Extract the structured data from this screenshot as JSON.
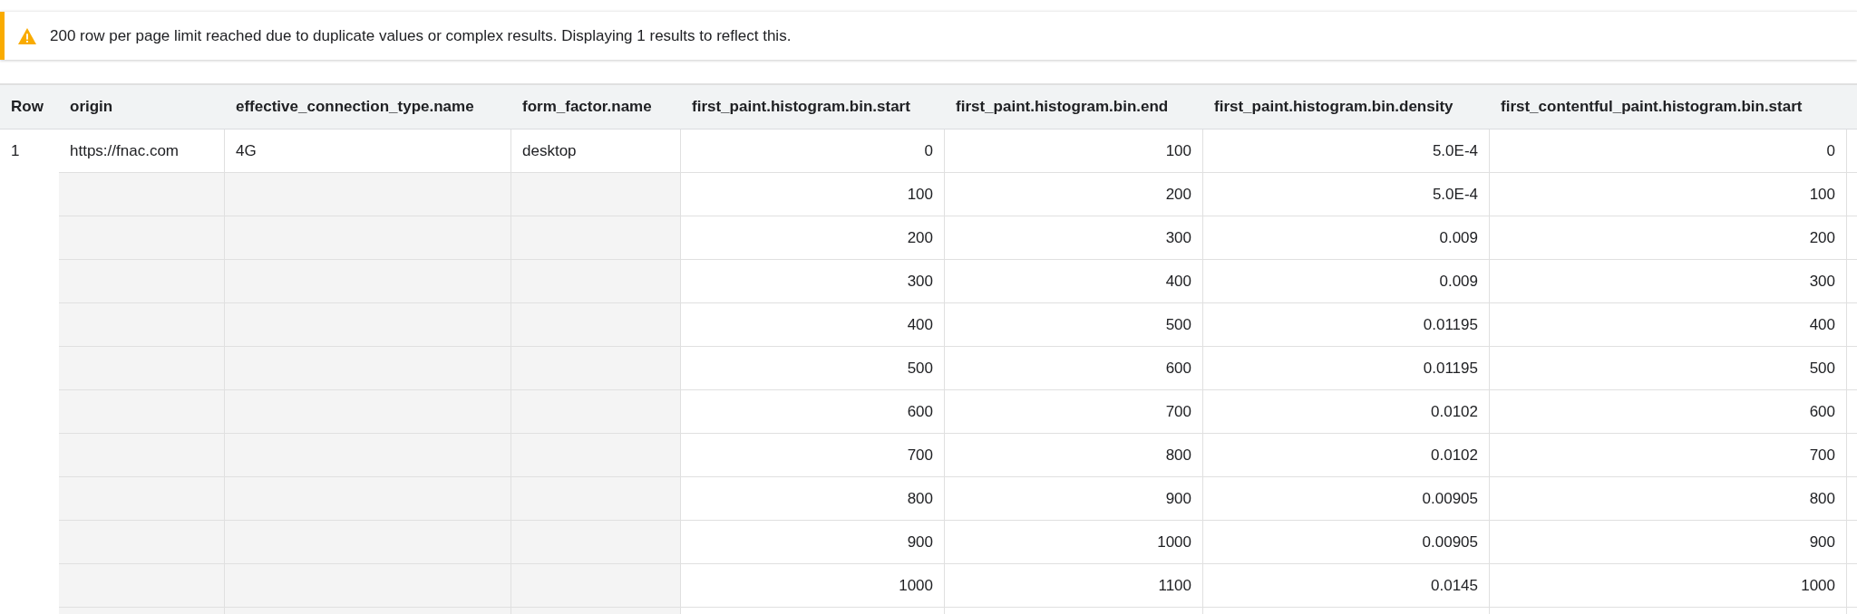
{
  "banner": {
    "kind": "warning",
    "text": "200 row per page limit reached due to duplicate values or complex results. Displaying 1 results to reflect this."
  },
  "table": {
    "columns": [
      "Row",
      "origin",
      "effective_connection_type.name",
      "form_factor.name",
      "first_paint.histogram.bin.start",
      "first_paint.histogram.bin.end",
      "first_paint.histogram.bin.density",
      "first_contentful_paint.histogram.bin.start"
    ],
    "rows": [
      {
        "row": "1",
        "origin": "https://fnac.com",
        "effective_connection_type": "4G",
        "form_factor": "desktop",
        "bins": [
          [
            "0",
            "100",
            "5.0E-4",
            "0"
          ],
          [
            "100",
            "200",
            "5.0E-4",
            "100"
          ],
          [
            "200",
            "300",
            "0.009",
            "200"
          ],
          [
            "300",
            "400",
            "0.009",
            "300"
          ],
          [
            "400",
            "500",
            "0.01195",
            "400"
          ],
          [
            "500",
            "600",
            "0.01195",
            "500"
          ],
          [
            "600",
            "700",
            "0.0102",
            "600"
          ],
          [
            "700",
            "800",
            "0.0102",
            "700"
          ],
          [
            "800",
            "900",
            "0.00905",
            "800"
          ],
          [
            "900",
            "1000",
            "0.00905",
            "900"
          ],
          [
            "1000",
            "1100",
            "0.0145",
            "1000"
          ]
        ]
      }
    ]
  }
}
